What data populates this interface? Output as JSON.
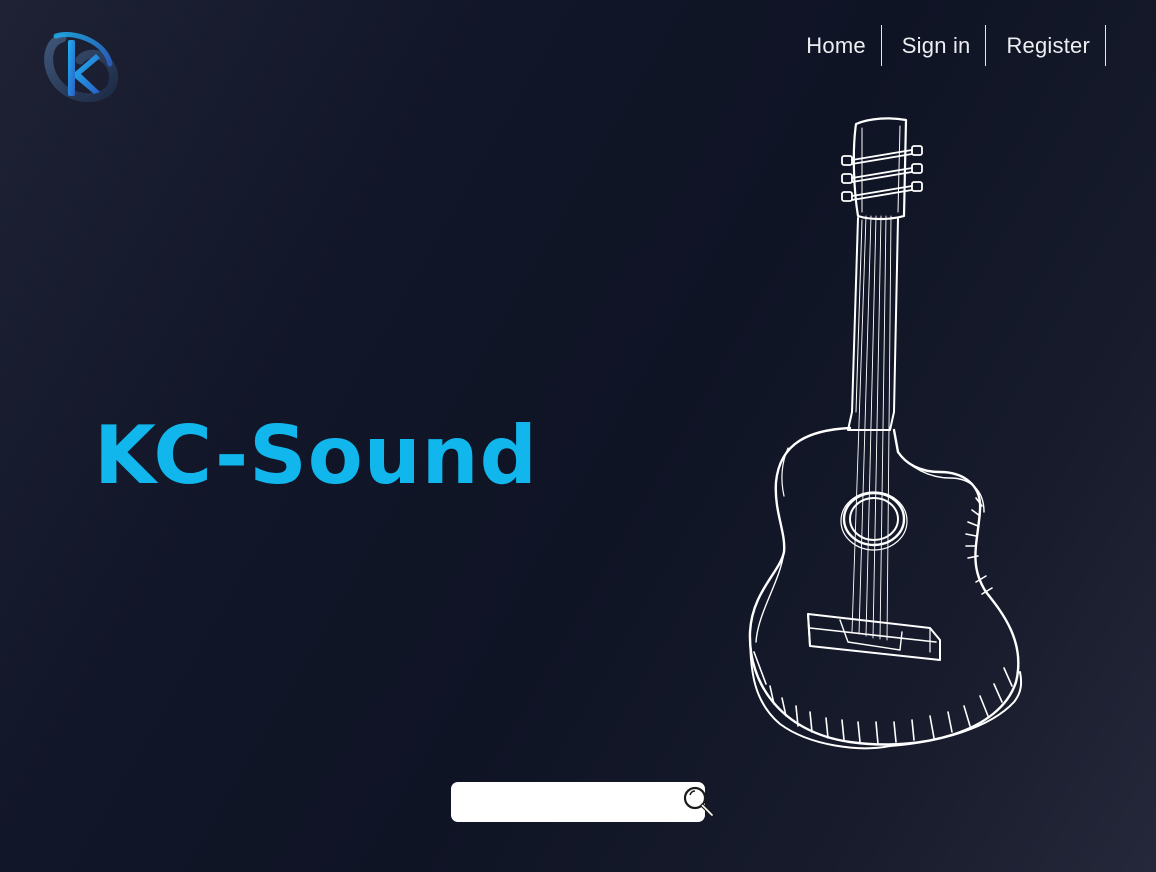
{
  "brand": {
    "logo_icon": "kc-logo-icon",
    "title": "KC-Sound",
    "accent_color": "#10b6ec"
  },
  "nav": {
    "items": [
      {
        "label": "Home"
      },
      {
        "label": "Sign in"
      },
      {
        "label": "Register"
      }
    ]
  },
  "hero": {
    "illustration": "guitar-sketch"
  },
  "search": {
    "value": "",
    "placeholder": "",
    "icon": "search-icon"
  },
  "colors": {
    "background_dark": "#0f1425",
    "text": "#ffffff"
  }
}
